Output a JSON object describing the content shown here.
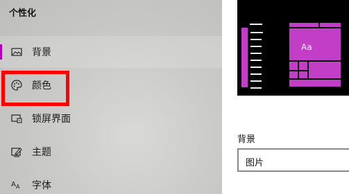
{
  "sidebar": {
    "title": "个性化",
    "items": [
      {
        "label": "背景",
        "icon": "picture-icon"
      },
      {
        "label": "颜色",
        "icon": "palette-icon"
      },
      {
        "label": "锁屏界面",
        "icon": "lock-screen-icon"
      },
      {
        "label": "主题",
        "icon": "theme-icon"
      },
      {
        "label": "字体",
        "icon": "font-icon"
      }
    ],
    "selected_index": 0
  },
  "preview": {
    "tile_text": "Aa",
    "accent_color": "#c23ec7"
  },
  "background_section": {
    "label": "背景",
    "dropdown_value": "图片"
  },
  "colors": {
    "highlight": "#ff0000",
    "selection_accent": "#b000b5"
  }
}
